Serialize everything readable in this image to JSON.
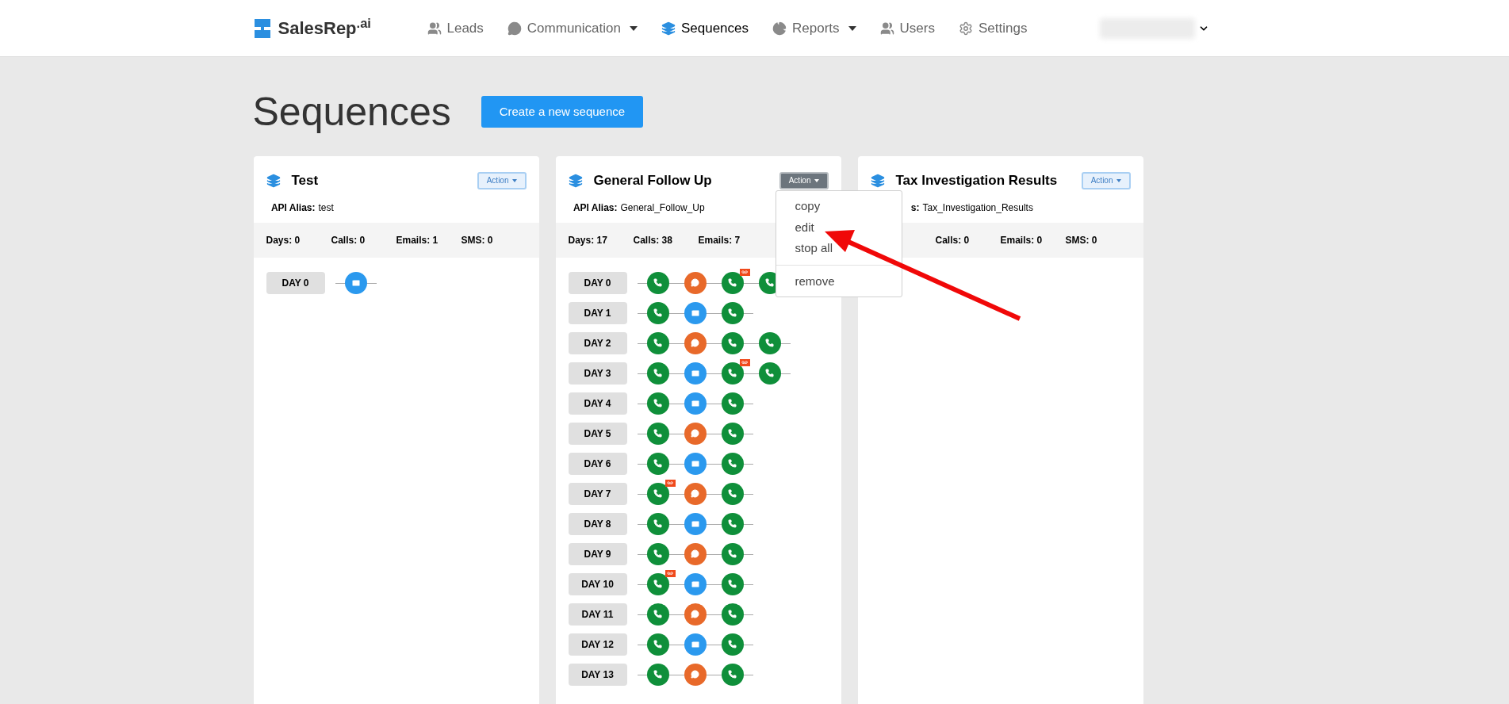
{
  "header": {
    "logo": "SalesRep$^{.ai}$",
    "nav": [
      {
        "label": "Leads",
        "caret": false,
        "selected": false
      },
      {
        "label": "Communication",
        "caret": true,
        "selected": false
      },
      {
        "label": "Sequences",
        "caret": false,
        "selected": true
      },
      {
        "label": "Reports",
        "caret": true,
        "selected": false
      },
      {
        "label": "Users",
        "caret": false,
        "selected": false
      },
      {
        "label": "Settings",
        "caret": false,
        "selected": false
      }
    ]
  },
  "page": {
    "title": "Sequences",
    "create_button": "Create a new sequence"
  },
  "cards": [
    {
      "title": "Test",
      "action": {
        "label": "Action",
        "open": false
      },
      "alias_label": "API Alias:",
      "alias": "test",
      "stats": [
        {
          "kind": "days",
          "text": "Days: 0"
        },
        {
          "kind": "calls",
          "text": "Calls: 0"
        },
        {
          "kind": "emails",
          "text": "Emails: 1"
        },
        {
          "kind": "sms",
          "text": "SMS: 0"
        }
      ],
      "days": [
        {
          "label": "DAY 0",
          "steps": [
            {
              "kind": "email",
              "voicemail": false
            }
          ]
        }
      ]
    },
    {
      "title": "General Follow Up",
      "action": {
        "label": "Action",
        "open": true,
        "menu": [
          "copy",
          "edit",
          "stop all",
          "remove"
        ]
      },
      "alias_label": "API Alias:",
      "alias": "General_Follow_Up",
      "stats": [
        {
          "kind": "days",
          "text": "Days: 17"
        },
        {
          "kind": "calls",
          "text": "Calls: 38"
        },
        {
          "kind": "emails",
          "text": "Emails: 7"
        }
      ],
      "days": [
        {
          "label": "DAY 0",
          "steps": [
            {
              "kind": "call",
              "voicemail": false
            },
            {
              "kind": "sms",
              "voicemail": false
            },
            {
              "kind": "call",
              "voicemail": true
            },
            {
              "kind": "call",
              "voicemail": false
            }
          ]
        },
        {
          "label": "DAY 1",
          "steps": [
            {
              "kind": "call",
              "voicemail": false
            },
            {
              "kind": "email",
              "voicemail": false
            },
            {
              "kind": "call",
              "voicemail": false
            }
          ]
        },
        {
          "label": "DAY 2",
          "steps": [
            {
              "kind": "call",
              "voicemail": false
            },
            {
              "kind": "sms",
              "voicemail": false
            },
            {
              "kind": "call",
              "voicemail": false
            },
            {
              "kind": "call",
              "voicemail": false
            }
          ]
        },
        {
          "label": "DAY 3",
          "steps": [
            {
              "kind": "call",
              "voicemail": false
            },
            {
              "kind": "email",
              "voicemail": false
            },
            {
              "kind": "call",
              "voicemail": true
            },
            {
              "kind": "call",
              "voicemail": false
            }
          ]
        },
        {
          "label": "DAY 4",
          "steps": [
            {
              "kind": "call",
              "voicemail": false
            },
            {
              "kind": "email",
              "voicemail": false
            },
            {
              "kind": "call",
              "voicemail": false
            }
          ]
        },
        {
          "label": "DAY 5",
          "steps": [
            {
              "kind": "call",
              "voicemail": false
            },
            {
              "kind": "sms",
              "voicemail": false
            },
            {
              "kind": "call",
              "voicemail": false
            }
          ]
        },
        {
          "label": "DAY 6",
          "steps": [
            {
              "kind": "call",
              "voicemail": false
            },
            {
              "kind": "email",
              "voicemail": false
            },
            {
              "kind": "call",
              "voicemail": false
            }
          ]
        },
        {
          "label": "DAY 7",
          "steps": [
            {
              "kind": "call",
              "voicemail": true
            },
            {
              "kind": "sms",
              "voicemail": false
            },
            {
              "kind": "call",
              "voicemail": false
            }
          ]
        },
        {
          "label": "DAY 8",
          "steps": [
            {
              "kind": "call",
              "voicemail": false
            },
            {
              "kind": "email",
              "voicemail": false
            },
            {
              "kind": "call",
              "voicemail": false
            }
          ]
        },
        {
          "label": "DAY 9",
          "steps": [
            {
              "kind": "call",
              "voicemail": false
            },
            {
              "kind": "sms",
              "voicemail": false
            },
            {
              "kind": "call",
              "voicemail": false
            }
          ]
        },
        {
          "label": "DAY 10",
          "steps": [
            {
              "kind": "call",
              "voicemail": true
            },
            {
              "kind": "email",
              "voicemail": false
            },
            {
              "kind": "call",
              "voicemail": false
            }
          ]
        },
        {
          "label": "DAY 11",
          "steps": [
            {
              "kind": "call",
              "voicemail": false
            },
            {
              "kind": "sms",
              "voicemail": false
            },
            {
              "kind": "call",
              "voicemail": false
            }
          ]
        },
        {
          "label": "DAY 12",
          "steps": [
            {
              "kind": "call",
              "voicemail": false
            },
            {
              "kind": "email",
              "voicemail": false
            },
            {
              "kind": "call",
              "voicemail": false
            }
          ]
        },
        {
          "label": "DAY 13",
          "steps": [
            {
              "kind": "call",
              "voicemail": false
            },
            {
              "kind": "sms",
              "voicemail": false
            },
            {
              "kind": "call",
              "voicemail": false
            }
          ]
        }
      ]
    },
    {
      "title": "Tax Investigation Results",
      "action": {
        "label": "Action",
        "open": false
      },
      "alias_label": "s:",
      "alias": "Tax_Investigation_Results",
      "stats": [
        {
          "kind": "calls",
          "text": "Calls: 0"
        },
        {
          "kind": "emails",
          "text": "Emails: 0"
        },
        {
          "kind": "sms",
          "text": "SMS: 0"
        }
      ]
    }
  ]
}
